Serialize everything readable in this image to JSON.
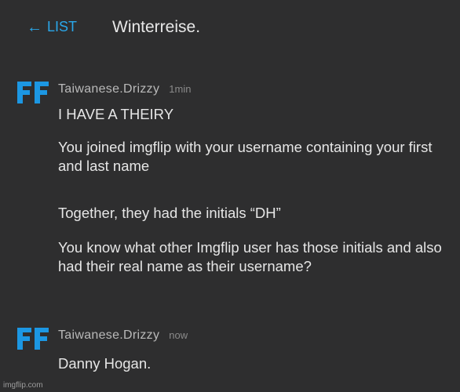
{
  "header": {
    "back_arrow": "←",
    "back_label": "LIST",
    "title": "Winterreise."
  },
  "messages": [
    {
      "avatar_text": "FF",
      "username": "Taiwanese.Drizzy",
      "time": "1min",
      "paragraphs": [
        "I HAVE A THEIRY",
        "You joined imgflip with your username containing your first and last name",
        "Together, they had the initials “DH”",
        "You know what other Imgflip user has those initials and also had their real name as their username?"
      ]
    },
    {
      "avatar_text": "FF",
      "username": "Taiwanese.Drizzy",
      "time": "now",
      "paragraphs": [
        "Danny Hogan."
      ]
    }
  ],
  "watermark": "imgflip.com",
  "colors": {
    "background": "#2e2e2f",
    "accent": "#2aa7ea",
    "avatar": "#1c97e3",
    "text": "#e6e6e6",
    "muted": "#b9b9b9"
  },
  "icons": {
    "back": "left-arrow-icon",
    "avatar": "ff-logo-icon"
  }
}
